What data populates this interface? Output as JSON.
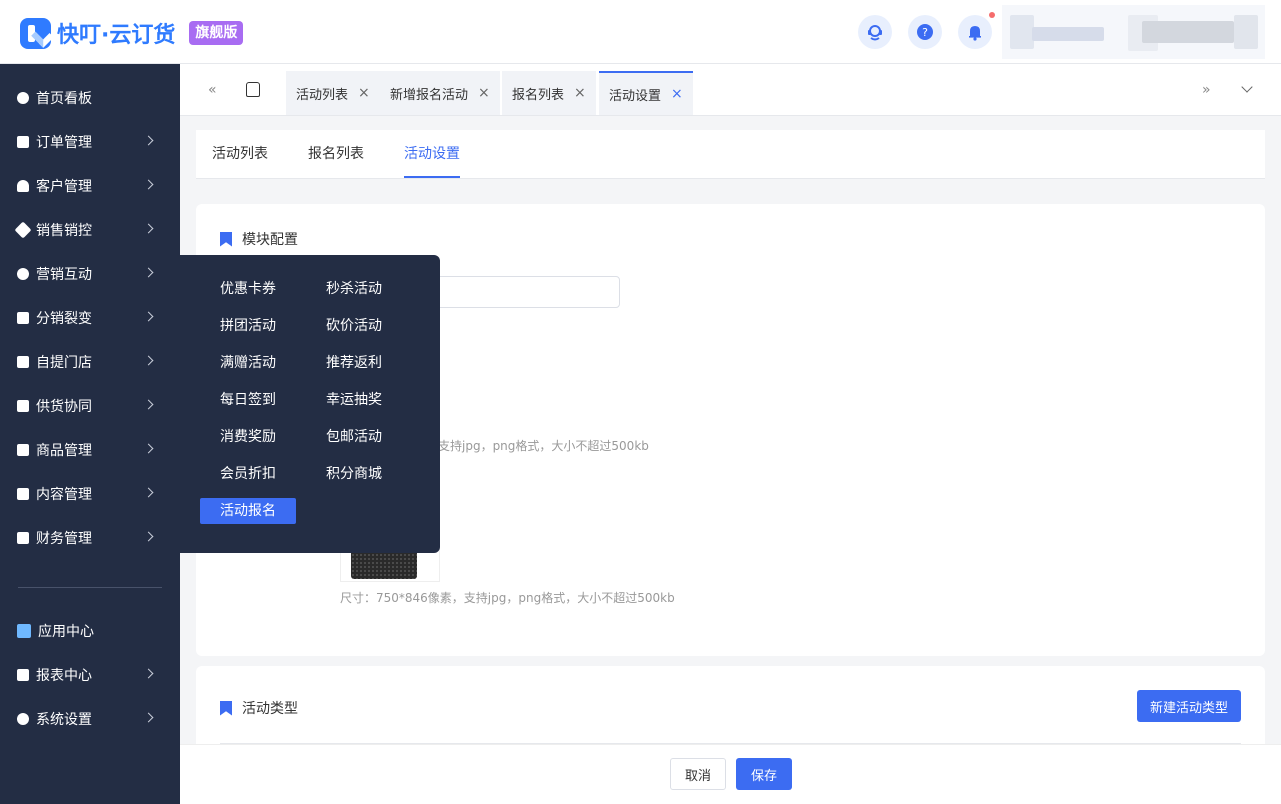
{
  "header": {
    "app_name": "快叮·云订货",
    "badge": "旗舰版",
    "icons": [
      "customer-service-icon",
      "help-icon",
      "bell-icon"
    ]
  },
  "sidebar": {
    "items": [
      {
        "label": "首页看板",
        "icon": "dashboard-icon",
        "has_arrow": false
      },
      {
        "label": "订单管理",
        "icon": "clipboard-icon",
        "has_arrow": true
      },
      {
        "label": "客户管理",
        "icon": "user-icon",
        "has_arrow": true
      },
      {
        "label": "销售销控",
        "icon": "tag-icon",
        "has_arrow": true
      },
      {
        "label": "营销互动",
        "icon": "target-icon",
        "has_arrow": true
      },
      {
        "label": "分销裂变",
        "icon": "sitemap-icon",
        "has_arrow": true
      },
      {
        "label": "自提门店",
        "icon": "store-icon",
        "has_arrow": true
      },
      {
        "label": "供货协同",
        "icon": "supplier-icon",
        "has_arrow": true
      },
      {
        "label": "商品管理",
        "icon": "bag-icon",
        "has_arrow": true
      },
      {
        "label": "内容管理",
        "icon": "document-icon",
        "has_arrow": true
      },
      {
        "label": "财务管理",
        "icon": "wallet-icon",
        "has_arrow": true
      }
    ],
    "bottom_items": [
      {
        "label": "应用中心",
        "icon": "cube-icon",
        "has_arrow": false
      },
      {
        "label": "报表中心",
        "icon": "bar-chart-icon",
        "has_arrow": true
      },
      {
        "label": "系统设置",
        "icon": "gear-icon",
        "has_arrow": true
      }
    ]
  },
  "tabbar": {
    "tabs": [
      {
        "label": "活动列表"
      },
      {
        "label": "新增报名活动"
      },
      {
        "label": "报名列表"
      },
      {
        "label": "活动设置"
      }
    ],
    "close_glyph": "×"
  },
  "subtabs": [
    "活动列表",
    "报名列表",
    "活动设置"
  ],
  "module_section": {
    "title": "模块配置",
    "hint_partial": "，支持jpg，png格式，大小不超过500kb",
    "hint_full": "尺寸：750*846像素，支持jpg，png格式，大小不超过500kb"
  },
  "type_section": {
    "title": "活动类型",
    "new_button": "新建活动类型"
  },
  "footer": {
    "cancel": "取消",
    "save": "保存"
  },
  "popup_menu": {
    "items": [
      "优惠卡券",
      "秒杀活动",
      "拼团活动",
      "砍价活动",
      "满赠活动",
      "推荐返利",
      "每日签到",
      "幸运抽奖",
      "消费奖励",
      "包邮活动",
      "会员折扣",
      "积分商城",
      "活动报名"
    ],
    "active": "活动报名"
  },
  "colors": {
    "primary": "#3c6cf2",
    "sidebar_bg": "#232d44",
    "badge": "#a86cf2",
    "notification_dot": "#f56c6c"
  }
}
